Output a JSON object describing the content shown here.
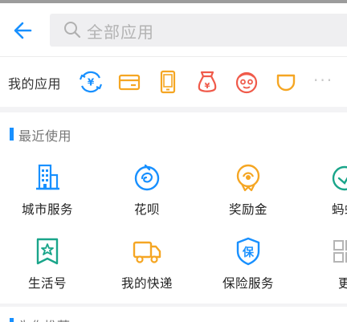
{
  "search": {
    "placeholder": "全部应用"
  },
  "my_apps": {
    "label": "我的应用",
    "icons": [
      "yuan-exchange-icon",
      "card-icon",
      "phone-icon",
      "money-bag-icon",
      "face-icon",
      "cup-icon"
    ],
    "more": "···"
  },
  "recent": {
    "title": "最近使用",
    "items": [
      {
        "label": "城市服务",
        "icon": "city-building-icon"
      },
      {
        "label": "花呗",
        "icon": "huabei-icon"
      },
      {
        "label": "奖励金",
        "icon": "reward-icon"
      },
      {
        "label": "蚂蚁",
        "icon": "ant-icon"
      },
      {
        "label": "生活号",
        "icon": "life-account-icon"
      },
      {
        "label": "我的快递",
        "icon": "truck-icon"
      },
      {
        "label": "保险服务",
        "icon": "insurance-shield-icon"
      },
      {
        "label": "更",
        "icon": "more-grid-icon"
      }
    ]
  },
  "next_section": {
    "title": "为你推荐"
  },
  "colors": {
    "blue": "#1890ff",
    "orange": "#f5a623",
    "red": "#f05a4a",
    "teal": "#1aa58a"
  }
}
